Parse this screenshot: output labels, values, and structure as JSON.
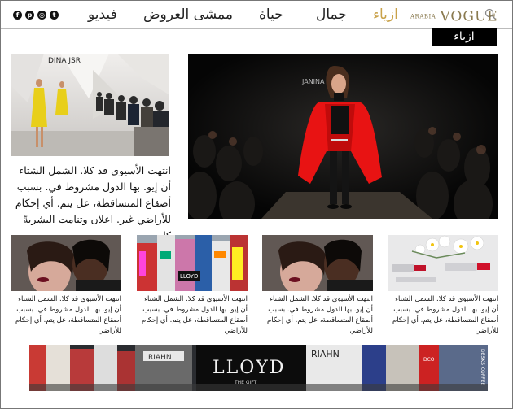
{
  "nav": {
    "brand_small": "ARABIA",
    "brand_big": "VOGUE",
    "items": [
      "ازياء",
      "جمال",
      "حياة",
      "ممشى العروض",
      "فيديو"
    ],
    "active_index": 0,
    "accent_color": "#c9a24a"
  },
  "section_label": "ازياء",
  "side_image_sign": "DINA JSR",
  "side_text": "انتهت الأسيوي قد كلا. الشمل الشتاء أن إيو. بها الدول مشروط في. بسبب أصقاع المتساقطة، عل يتم. أي إحكام للأراضي غير. اعلان وتنامت البشريةً كل",
  "hero_sign": "JANINA",
  "cards": [
    {
      "text": "انتهت الأسيوي قد كلا. الشمل الشتاء أن إيو. بها الدول مشروط في. بسبب أصقاع المتساقطة، عل يتم. أي إحكام للأراضي"
    },
    {
      "text": "انتهت الأسيوي قد كلا. الشمل الشتاء أن إيو. بها الدول مشروط في. بسبب أصقاع المتساقطة، عل يتم. أي إحكام للأراضي"
    },
    {
      "text": "انتهت الأسيوي قد كلا. الشمل الشتاء أن إيو. بها الدول مشروط في. بسبب أصقاع المتساقطة، عل يتم. أي إحكام للأراضي"
    },
    {
      "text": "انتهت الأسيوي قد كلا. الشمل الشتاء أن إيو. بها الدول مشروط في. بسبب أصقاع المتساقطة، عل يتم. أي إحكام للأراضي"
    }
  ],
  "card_signs": {
    "lloyd": "LLOYD"
  },
  "banner": {
    "main_sign": "LLOYD",
    "main_sub": "THE GIFT",
    "left_sign": "RIAHN",
    "right_sign": "RIAHN",
    "far_sign": "DESKS COFFEE",
    "small_sign": "DCO"
  }
}
